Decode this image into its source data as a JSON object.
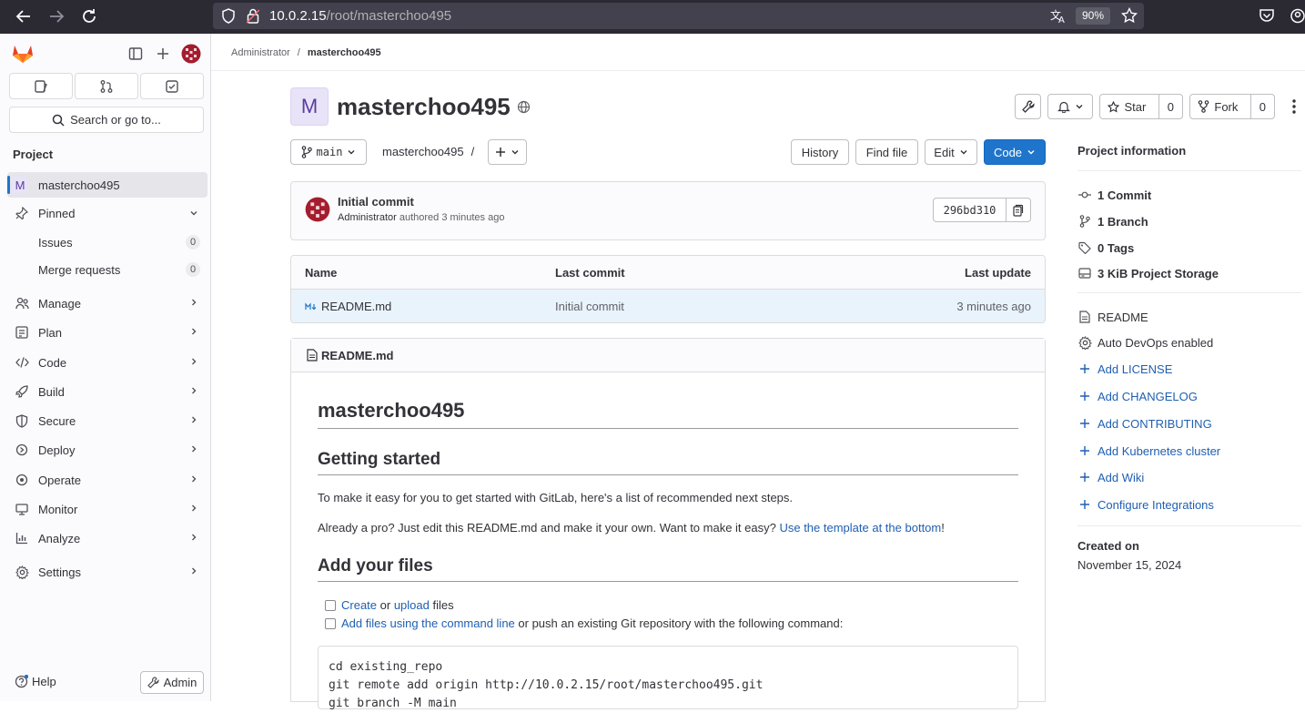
{
  "browser": {
    "url_host": "10.0.2.15",
    "url_path": "/root/masterchoo495",
    "zoom": "90%"
  },
  "sidebar": {
    "search_placeholder": "Search or go to...",
    "section_title": "Project",
    "project_initial": "M",
    "project_name": "masterchoo495",
    "pinned_label": "Pinned",
    "pinned_items": [
      {
        "label": "Issues",
        "count": "0"
      },
      {
        "label": "Merge requests",
        "count": "0"
      }
    ],
    "menu": [
      {
        "label": "Manage",
        "icon": "users-icon"
      },
      {
        "label": "Plan",
        "icon": "plan-icon"
      },
      {
        "label": "Code",
        "icon": "code-icon"
      },
      {
        "label": "Build",
        "icon": "rocket-icon"
      },
      {
        "label": "Secure",
        "icon": "shield-icon"
      },
      {
        "label": "Deploy",
        "icon": "deploy-icon"
      },
      {
        "label": "Operate",
        "icon": "cloud-gear-icon"
      },
      {
        "label": "Monitor",
        "icon": "monitor-icon"
      },
      {
        "label": "Analyze",
        "icon": "chart-icon"
      },
      {
        "label": "Settings",
        "icon": "settings-icon"
      }
    ],
    "help_label": "Help",
    "admin_label": "Admin"
  },
  "breadcrumb": {
    "parent": "Administrator",
    "separator": "/",
    "current": "masterchoo495"
  },
  "project": {
    "initial": "M",
    "title": "masterchoo495",
    "star_label": "Star",
    "star_count": "0",
    "fork_label": "Fork",
    "fork_count": "0"
  },
  "repo_toolbar": {
    "branch": "main",
    "path": "masterchoo495",
    "path_sep": "/",
    "history": "History",
    "find_file": "Find file",
    "edit": "Edit",
    "code": "Code"
  },
  "last_commit": {
    "title": "Initial commit",
    "author": "Administrator",
    "meta": "authored 3 minutes ago",
    "sha": "296bd310"
  },
  "file_table": {
    "headers": [
      "Name",
      "Last commit",
      "Last update"
    ],
    "rows": [
      {
        "name": "README.md",
        "commit": "Initial commit",
        "updated": "3 minutes ago"
      }
    ]
  },
  "readme": {
    "filename": "README.md",
    "h1": "masterchoo495",
    "h2_getting_started": "Getting started",
    "p1": "To make it easy for you to get started with GitLab, here's a list of recommended next steps.",
    "p2_prefix": "Already a pro? Just edit this README.md and make it your own. Want to make it easy? ",
    "p2_link": "Use the template at the bottom",
    "p2_suffix": "!",
    "h2_add_files": "Add your files",
    "task1_link1": "Create",
    "task1_mid": " or ",
    "task1_link2": "upload",
    "task1_suffix": " files",
    "task2_link": "Add files using the command line",
    "task2_suffix": " or push an existing Git repository with the following command:",
    "code_lines": "cd existing_repo\ngit remote add origin http://10.0.2.15/root/masterchoo495.git\ngit branch -M main"
  },
  "project_info": {
    "title": "Project information",
    "stats": [
      {
        "label": "1 Commit",
        "icon": "commit-icon"
      },
      {
        "label": "1 Branch",
        "icon": "branch-icon"
      },
      {
        "label": "0 Tags",
        "icon": "tag-icon"
      },
      {
        "label": "3 KiB Project Storage",
        "icon": "storage-icon"
      }
    ],
    "links": [
      {
        "label": "README",
        "icon": "doc-icon"
      },
      {
        "label": "Auto DevOps enabled",
        "icon": "gear-icon"
      }
    ],
    "adds": [
      "Add LICENSE",
      "Add CHANGELOG",
      "Add CONTRIBUTING",
      "Add Kubernetes cluster",
      "Add Wiki",
      "Configure Integrations"
    ],
    "created_label": "Created on",
    "created_date": "November 15, 2024"
  },
  "colors": {
    "link": "#1f5fb2",
    "primary_button": "#1f75cb",
    "gitlab_orange": "#e24329"
  }
}
